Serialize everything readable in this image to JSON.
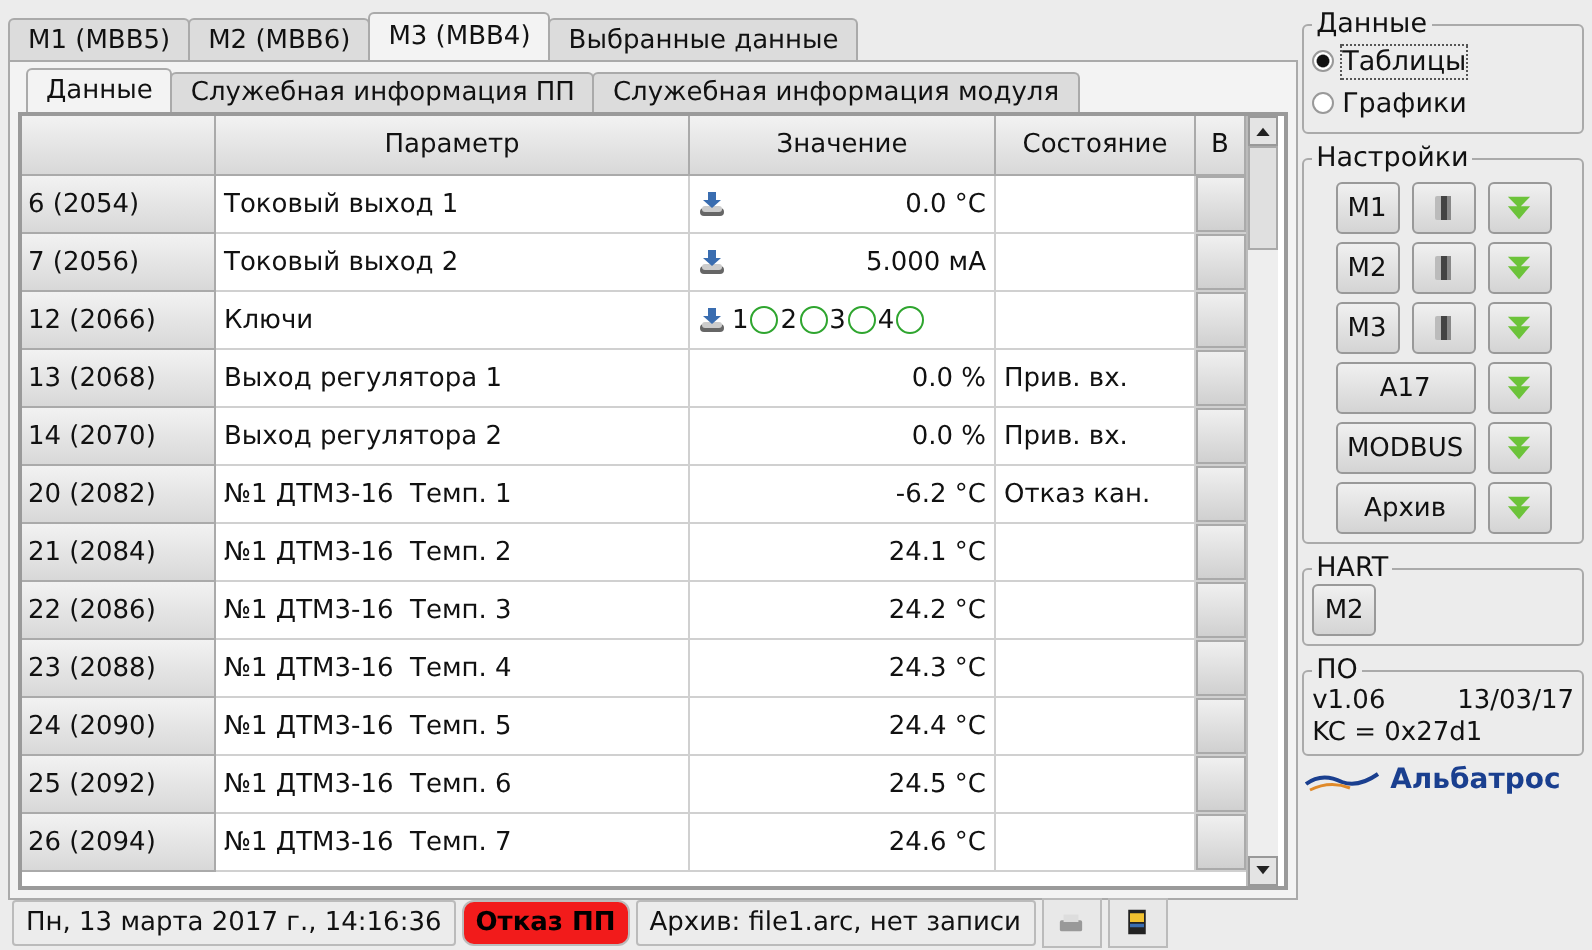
{
  "tabs": [
    {
      "label": "M1 (MBB5)",
      "selected": false
    },
    {
      "label": "M2 (MBB6)",
      "selected": false
    },
    {
      "label": "M3 (MBB4)",
      "selected": true
    },
    {
      "label": "Выбранные данные",
      "selected": false
    }
  ],
  "subtabs": [
    {
      "label": "Данные",
      "selected": true
    },
    {
      "label": "Служебная информация ПП",
      "selected": false
    },
    {
      "label": "Служебная информация модуля",
      "selected": false
    }
  ],
  "table": {
    "columns": [
      "Параметр",
      "Значение",
      "Состояние",
      "B"
    ],
    "rows": [
      {
        "id": "6 (2054)",
        "parameter": "Токовый выход 1",
        "kind": "output",
        "value": "0.0 °C",
        "state": ""
      },
      {
        "id": "7 (2056)",
        "parameter": "Токовый выход 2",
        "kind": "output",
        "value": "5.000 мА",
        "state": ""
      },
      {
        "id": "12 (2066)",
        "parameter": "Ключи",
        "kind": "keys",
        "keys": [
          {
            "label": "1",
            "on": false
          },
          {
            "label": "2",
            "on": false
          },
          {
            "label": "3",
            "on": false
          },
          {
            "label": "4",
            "on": false
          }
        ],
        "state": ""
      },
      {
        "id": "13 (2068)",
        "parameter": "Выход регулятора 1",
        "kind": "value",
        "value": "0.0 %",
        "state": "Прив. вх."
      },
      {
        "id": "14 (2070)",
        "parameter": "Выход регулятора 2",
        "kind": "value",
        "value": "0.0 %",
        "state": "Прив. вх."
      },
      {
        "id": "20 (2082)",
        "parameter": "№1 ДТМ3-16  Темп. 1",
        "kind": "value",
        "value": "-6.2 °C",
        "state": "Отказ кан."
      },
      {
        "id": "21 (2084)",
        "parameter": "№1 ДТМ3-16  Темп. 2",
        "kind": "value",
        "value": "24.1 °C",
        "state": ""
      },
      {
        "id": "22 (2086)",
        "parameter": "№1 ДТМ3-16  Темп. 3",
        "kind": "value",
        "value": "24.2 °C",
        "state": ""
      },
      {
        "id": "23 (2088)",
        "parameter": "№1 ДТМ3-16  Темп. 4",
        "kind": "value",
        "value": "24.3 °C",
        "state": ""
      },
      {
        "id": "24 (2090)",
        "parameter": "№1 ДТМ3-16  Темп. 5",
        "kind": "value",
        "value": "24.4 °C",
        "state": ""
      },
      {
        "id": "25 (2092)",
        "parameter": "№1 ДТМ3-16  Темп. 6",
        "kind": "value",
        "value": "24.5 °C",
        "state": ""
      },
      {
        "id": "26 (2094)",
        "parameter": "№1 ДТМ3-16  Темп. 7",
        "kind": "value",
        "value": "24.6 °C",
        "state": ""
      }
    ]
  },
  "data_group": {
    "title": "Данные",
    "options": [
      {
        "label": "Таблицы",
        "selected": true
      },
      {
        "label": "Графики",
        "selected": false
      }
    ]
  },
  "settings_group": {
    "title": "Настройки",
    "rows": [
      {
        "label": "M1",
        "kind": "module"
      },
      {
        "label": "M2",
        "kind": "module"
      },
      {
        "label": "M3",
        "kind": "module"
      },
      {
        "label": "A17",
        "kind": "wide"
      },
      {
        "label": "MODBUS",
        "kind": "wide"
      },
      {
        "label": "Архив",
        "kind": "wide"
      }
    ]
  },
  "hart_group": {
    "title": "HART",
    "button": "M2"
  },
  "software_group": {
    "title": "ПО",
    "version": "v1.06",
    "date": "13/03/17",
    "checksum": "KC = 0x27d1"
  },
  "logo": "Альбатрос",
  "status_bar": {
    "datetime": "Пн, 13 марта 2017 г., 14:16:36",
    "alarm": "Отказ ПП",
    "alarm_active": true,
    "archive": "Архив: file1.arc, нет записи"
  }
}
